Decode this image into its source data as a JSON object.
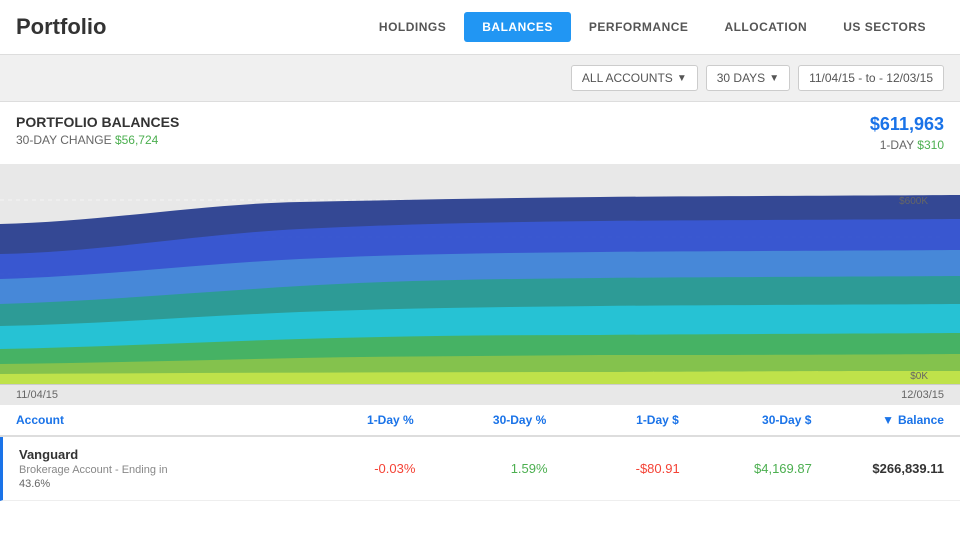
{
  "header": {
    "title": "Portfolio",
    "nav": [
      {
        "label": "HOLDINGS",
        "active": false
      },
      {
        "label": "BALANCES",
        "active": true
      },
      {
        "label": "PERFORMANCE",
        "active": false
      },
      {
        "label": "ALLOCATION",
        "active": false
      },
      {
        "label": "US SECTORS",
        "active": false
      }
    ]
  },
  "toolbar": {
    "accounts_btn": "ALL ACCOUNTS",
    "period_btn": "30 DAYS",
    "date_from": "11/04/15",
    "date_to": "12/03/15",
    "date_separator": "- to -"
  },
  "stats": {
    "label": "PORTFOLIO BALANCES",
    "change_label": "30-DAY CHANGE",
    "change_value": "$56,724",
    "total_value": "$611,963",
    "day_label": "1-DAY",
    "day_value": "$310"
  },
  "chart": {
    "y_label_top": "$600K",
    "y_label_bottom": "$0K",
    "date_start": "11/04/15",
    "date_end": "12/03/15"
  },
  "table": {
    "columns": [
      {
        "label": "Account",
        "key": "account"
      },
      {
        "label": "1-Day %",
        "key": "day_pct"
      },
      {
        "label": "30-Day %",
        "key": "month_pct"
      },
      {
        "label": "1-Day $",
        "key": "day_dollar"
      },
      {
        "label": "30-Day $",
        "key": "month_dollar"
      },
      {
        "label": "Balance",
        "key": "balance",
        "sort": true
      }
    ],
    "rows": [
      {
        "name": "Vanguard",
        "sub": "Brokerage Account - Ending in",
        "pct_of_total": "43.6%",
        "day_pct": "-0.03%",
        "month_pct": "1.59%",
        "day_dollar": "-$80.91",
        "month_dollar": "$4,169.87",
        "balance": "$266,839.11",
        "day_pct_neg": true,
        "month_pct_pos": true,
        "day_dollar_neg": true,
        "month_dollar_pos": true
      }
    ]
  }
}
